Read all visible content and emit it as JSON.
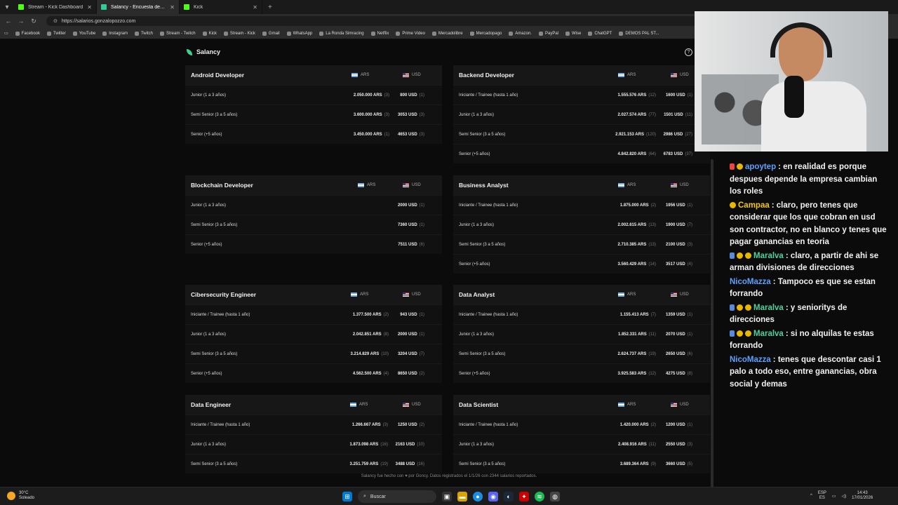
{
  "browser": {
    "tabs": [
      {
        "label": "Stream - Kick Dashboard",
        "active": false
      },
      {
        "label": "Salancy - Encuesta de Salarios IT ...",
        "active": true
      },
      {
        "label": "Kick",
        "active": false
      }
    ],
    "url": "https://salarios.gonzalopozzo.com",
    "bookmarks": [
      "Facebook",
      "Twitter",
      "YouTube",
      "Instagram",
      "Twitch",
      "Stream - Twitch",
      "Kick",
      "Stream - Kick",
      "Gmail",
      "WhatsApp",
      "La Ronda Simracing",
      "Netflix",
      "Prime Video",
      "Mercadolibre",
      "Mercadopago",
      "Amazon.",
      "PayPal",
      "Wise",
      "ChatGPT",
      "DEMOS PAL ST..."
    ]
  },
  "app": {
    "name": "Salancy",
    "currency_ars": "ARS",
    "currency_usd": "USD",
    "cards": [
      {
        "title": "Android Developer",
        "rows": [
          {
            "level": "Junior (1 a 3 años)",
            "ars": "2.050.000 ARS",
            "ars_n": "(3)",
            "usd": "800 USD",
            "usd_n": "(1)"
          },
          {
            "level": "Semi Senior (3 a 5 años)",
            "ars": "3.600.000 ARS",
            "ars_n": "(3)",
            "usd": "3053 USD",
            "usd_n": "(3)"
          },
          {
            "level": "Senior (+5 años)",
            "ars": "3.450.000 ARS",
            "ars_n": "(1)",
            "usd": "4653 USD",
            "usd_n": "(3)"
          }
        ]
      },
      {
        "title": "Backend Developer",
        "rows": [
          {
            "level": "Iniciante / Trainee (hasta 1 año)",
            "ars": "1.555.576 ARS",
            "ars_n": "(12)",
            "usd": "1600 USD",
            "usd_n": "(1)"
          },
          {
            "level": "Junior (1 a 3 años)",
            "ars": "2.027.574 ARS",
            "ars_n": "(77)",
            "usd": "1501 USD",
            "usd_n": "(11)"
          },
          {
            "level": "Semi Senior (3 a 5 años)",
            "ars": "2.921.153 ARS",
            "ars_n": "(120)",
            "usd": "2986 USD",
            "usd_n": "(27)"
          },
          {
            "level": "Senior (+5 años)",
            "ars": "4.842.820 ARS",
            "ars_n": "(64)",
            "usd": "6783 USD",
            "usd_n": "(37)"
          }
        ]
      },
      {
        "title": "Blockchain Developer",
        "rows": [
          {
            "level": "Junior (1 a 3 años)",
            "ars": "",
            "ars_n": "",
            "usd": "2000 USD",
            "usd_n": "(1)"
          },
          {
            "level": "Semi Senior (3 a 5 años)",
            "ars": "",
            "ars_n": "",
            "usd": "7360 USD",
            "usd_n": "(1)"
          },
          {
            "level": "Senior (+5 años)",
            "ars": "",
            "ars_n": "",
            "usd": "7511 USD",
            "usd_n": "(6)"
          }
        ]
      },
      {
        "title": "Business Analyst",
        "rows": [
          {
            "level": "Iniciante / Trainee (hasta 1 año)",
            "ars": "1.875.000 ARS",
            "ars_n": "(2)",
            "usd": "1956 USD",
            "usd_n": "(1)"
          },
          {
            "level": "Junior (1 a 3 años)",
            "ars": "2.002.615 ARS",
            "ars_n": "(13)",
            "usd": "1900 USD",
            "usd_n": "(7)"
          },
          {
            "level": "Semi Senior (3 a 5 años)",
            "ars": "2.710.385 ARS",
            "ars_n": "(13)",
            "usd": "2100 USD",
            "usd_n": "(3)"
          },
          {
            "level": "Senior (+5 años)",
            "ars": "3.560.429 ARS",
            "ars_n": "(14)",
            "usd": "3517 USD",
            "usd_n": "(4)"
          }
        ]
      },
      {
        "title": "Cibersecurity Engineer",
        "rows": [
          {
            "level": "Iniciante / Trainee (hasta 1 año)",
            "ars": "1.377.500 ARS",
            "ars_n": "(2)",
            "usd": "943 USD",
            "usd_n": "(1)"
          },
          {
            "level": "Junior (1 a 3 años)",
            "ars": "2.042.851 ARS",
            "ars_n": "(8)",
            "usd": "2000 USD",
            "usd_n": "(1)"
          },
          {
            "level": "Semi Senior (3 a 5 años)",
            "ars": "3.214.829 ARS",
            "ars_n": "(10)",
            "usd": "3204 USD",
            "usd_n": "(7)"
          },
          {
            "level": "Senior (+5 años)",
            "ars": "4.562.500 ARS",
            "ars_n": "(4)",
            "usd": "8650 USD",
            "usd_n": "(2)"
          }
        ]
      },
      {
        "title": "Data Analyst",
        "rows": [
          {
            "level": "Iniciante / Trainee (hasta 1 año)",
            "ars": "1.155.413 ARS",
            "ars_n": "(7)",
            "usd": "1359 USD",
            "usd_n": "(1)"
          },
          {
            "level": "Junior (1 a 3 años)",
            "ars": "1.852.331 ARS",
            "ars_n": "(11)",
            "usd": "2070 USD",
            "usd_n": "(1)"
          },
          {
            "level": "Semi Senior (3 a 5 años)",
            "ars": "2.624.737 ARS",
            "ars_n": "(19)",
            "usd": "2650 USD",
            "usd_n": "(6)"
          },
          {
            "level": "Senior (+5 años)",
            "ars": "3.925.583 ARS",
            "ars_n": "(12)",
            "usd": "4275 USD",
            "usd_n": "(8)"
          }
        ]
      },
      {
        "title": "Data Engineer",
        "rows": [
          {
            "level": "Iniciante / Trainee (hasta 1 año)",
            "ars": "1.266.667 ARS",
            "ars_n": "(3)",
            "usd": "1250 USD",
            "usd_n": "(2)"
          },
          {
            "level": "Junior (1 a 3 años)",
            "ars": "1.873.098 ARS",
            "ars_n": "(16)",
            "usd": "2163 USD",
            "usd_n": "(10)"
          },
          {
            "level": "Semi Senior (3 a 5 años)",
            "ars": "3.251.759 ARS",
            "ars_n": "(19)",
            "usd": "3488 USD",
            "usd_n": "(16)"
          }
        ]
      },
      {
        "title": "Data Scientist",
        "rows": [
          {
            "level": "Iniciante / Trainee (hasta 1 año)",
            "ars": "1.420.000 ARS",
            "ars_n": "(2)",
            "usd": "1200 USD",
            "usd_n": "(1)"
          },
          {
            "level": "Junior (1 a 3 años)",
            "ars": "2.408.916 ARS",
            "ars_n": "(11)",
            "usd": "2550 USD",
            "usd_n": "(3)"
          },
          {
            "level": "Semi Senior (3 a 5 años)",
            "ars": "3.689.364 ARS",
            "ars_n": "(9)",
            "usd": "3660 USD",
            "usd_n": "(5)"
          }
        ]
      }
    ],
    "footer": "Salancy fue hecho con ♥ por Goncy. Datos registrados el 1/1/26 con 2344 salarios reportados."
  },
  "chat": [
    {
      "user": "apoytep",
      "user_color": "#5aa0ff",
      "badge": "pink+gold",
      "text": ": en realidad es porque despues depende la empresa cambian los roles"
    },
    {
      "user": "Campaa",
      "user_color": "#f0c419",
      "badge": "gold",
      "text": ": claro, pero tenes que considerar que los que cobran en usd son contractor, no en blanco y tenes que pagar ganancias en teoria"
    },
    {
      "user": "Maralva",
      "user_color": "#4fd0a0",
      "badge": "blue+gold+crown",
      "text": ": claro, a partir de ahi se arman divisiones de direcciones"
    },
    {
      "user": "NicoMazza",
      "user_color": "#5aa0ff",
      "badge": "",
      "text": ": Tampoco es que se estan forrando"
    },
    {
      "user": "Maralva",
      "user_color": "#4fd0a0",
      "badge": "blue+gold+crown",
      "text": ": y senioritys de direcciones"
    },
    {
      "user": "Maralva",
      "user_color": "#4fd0a0",
      "badge": "blue+gold+crown",
      "text": ": si no alquilas te estas forrando"
    },
    {
      "user": "NicoMazza",
      "user_color": "#5aa0ff",
      "badge": "",
      "text": ": tenes que descontar casi 1 palo a todo eso, entre ganancias, obra social y demas"
    }
  ],
  "taskbar": {
    "weather_temp": "30°C",
    "weather_desc": "Soleado",
    "search_placeholder": "Buscar",
    "lang_top": "ESP",
    "lang_bottom": "ES",
    "time": "14:43",
    "date": "17/01/2026"
  }
}
